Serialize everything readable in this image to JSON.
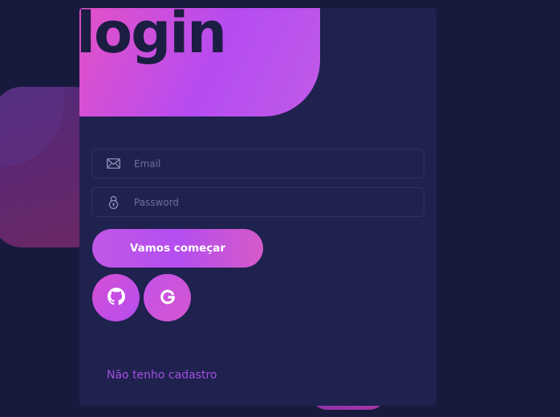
{
  "header": {
    "title": "login"
  },
  "form": {
    "email": {
      "placeholder": "Email",
      "value": "",
      "icon": "mail-icon"
    },
    "password": {
      "placeholder": "Password",
      "value": "",
      "icon": "lock-icon"
    },
    "submit_label": "Vamos começar"
  },
  "social": [
    {
      "name": "github",
      "icon": "github-icon"
    },
    {
      "name": "google",
      "icon": "google-icon"
    }
  ],
  "footer": {
    "signup_link": "Não tenho cadastro"
  },
  "colors": {
    "background": "#181a3d",
    "card": "#1f214f",
    "accent_pink": "#e451c7",
    "accent_purple": "#b64cf1",
    "link": "#a34fe0"
  }
}
